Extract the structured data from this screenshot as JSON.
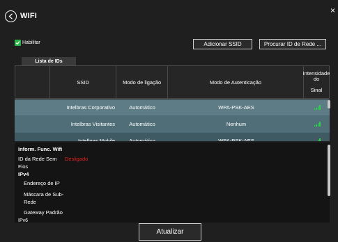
{
  "header": {
    "title": "WIFI",
    "close_glyph": "×"
  },
  "enable": {
    "label": "Habilitar",
    "checked": true
  },
  "toolbar": {
    "add_ssid_label": "Adicionar SSID",
    "search_network_label": "Procurar ID de Rede ..."
  },
  "tab": {
    "label": "Lista de IDs"
  },
  "table": {
    "columns": {
      "ssid": "SSID",
      "mode": "Modo de ligação",
      "auth": "Modo de Autenticação",
      "signal_line1": "Intensidade do",
      "signal_line2": "Sinal"
    },
    "rows": [
      {
        "ssid": "Intelbras Corporativo",
        "mode": "Automático",
        "auth": "WPA-PSK-AES",
        "signal": "signal-icon"
      },
      {
        "ssid": "Intelbras Visitantes",
        "mode": "Automático",
        "auth": "Nenhum",
        "signal": "signal-icon"
      },
      {
        "ssid": "Intelbras Mobile",
        "mode": "Automático",
        "auth": "WPA-PSK-AES",
        "signal": "signal-icon"
      }
    ]
  },
  "info": {
    "title": "Inform. Func. Wifi",
    "network_id_label_1": "ID da Rede Sem",
    "network_id_label_2": "Fios",
    "network_status": "Desligado",
    "ipv4": "IPv4",
    "ip_address": "Endereço de IP",
    "subnet_mask_1": "Máscara de Sub-",
    "subnet_mask_2": "Rede",
    "gateway": "Gateway Padrão",
    "ipv6_partial": "IPv6"
  },
  "footer": {
    "update_label": "Atualizar"
  },
  "colors": {
    "background": "#1f1f1f",
    "row_selected": "#5e7c86",
    "row": "#4f6e78",
    "signal": "#2bd34a",
    "status_off": "#e22020",
    "checkbox": "#2bb34a"
  }
}
